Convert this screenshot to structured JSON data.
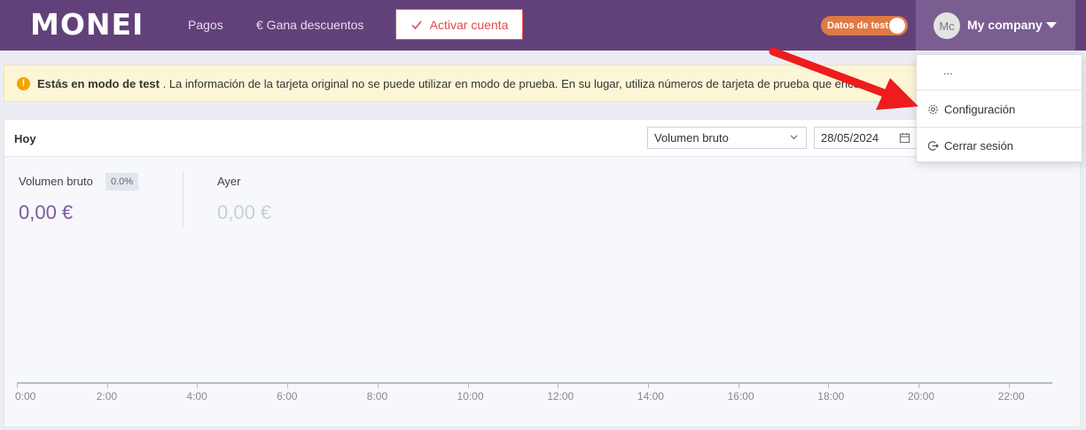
{
  "header": {
    "logo": "MONEI",
    "nav": [
      {
        "label": "Pagos"
      },
      {
        "label": "€ Gana descuentos"
      }
    ],
    "activate_button": "Activar cuenta",
    "test_toggle_label": "Datos de test",
    "account": {
      "initials": "Mc",
      "name": "My company"
    }
  },
  "banner": {
    "bold": "Estás en modo de test",
    "text": " . La información de la tarjeta original no se puede utilizar en modo de prueba. En su lugar, utiliza números de tarjeta de prueba que enco"
  },
  "dropdown": {
    "partial_item": "...",
    "items": [
      {
        "label": "Configuración",
        "icon": "gear-icon"
      },
      {
        "label": "Cerrar sesión",
        "icon": "logout-icon"
      }
    ]
  },
  "dashboard": {
    "title": "Hoy",
    "metric_select": "Volumen bruto",
    "date": "28/05/2024",
    "stats": [
      {
        "label": "Volumen bruto",
        "badge": "0.0%",
        "value": "0,00 €"
      },
      {
        "label": "Ayer",
        "value": "0,00 €"
      }
    ]
  },
  "chart_data": {
    "type": "line",
    "x": [
      "0:00",
      "2:00",
      "4:00",
      "6:00",
      "8:00",
      "10:00",
      "12:00",
      "14:00",
      "16:00",
      "18:00",
      "20:00",
      "22:00"
    ],
    "series": [],
    "title": "",
    "xlabel": "",
    "ylabel": ""
  },
  "colors": {
    "topbar": "#62417a",
    "accent_red": "#e24b4b",
    "toggle": "#e07a45",
    "value_primary": "#7e5a98",
    "value_muted": "#c9cdd5"
  }
}
